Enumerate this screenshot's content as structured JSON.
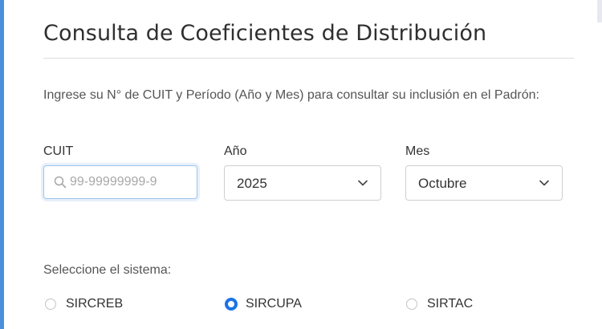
{
  "page": {
    "title": "Consulta de Coeficientes de Distribución",
    "intro": "Ingrese su N° de CUIT y Período (Año y Mes) para consultar su inclusión en el Padrón:"
  },
  "form": {
    "cuit": {
      "label": "CUIT",
      "placeholder": "99-99999999-9",
      "value": ""
    },
    "year": {
      "label": "Año",
      "selected": "2025"
    },
    "month": {
      "label": "Mes",
      "selected": "Octubre"
    }
  },
  "system": {
    "prompt": "Seleccione el sistema:",
    "options": [
      {
        "label": "SIRCREB",
        "checked": false
      },
      {
        "label": "SIRCUPA",
        "checked": true
      },
      {
        "label": "SIRTAC",
        "checked": false
      }
    ]
  },
  "colors": {
    "accent": "#1a73e8",
    "left_bar": "#4a8fdb",
    "focus_border": "#9cc4f0"
  },
  "icons": {
    "cuit_input": "search-icon",
    "selects": "chevron-down-icon"
  }
}
